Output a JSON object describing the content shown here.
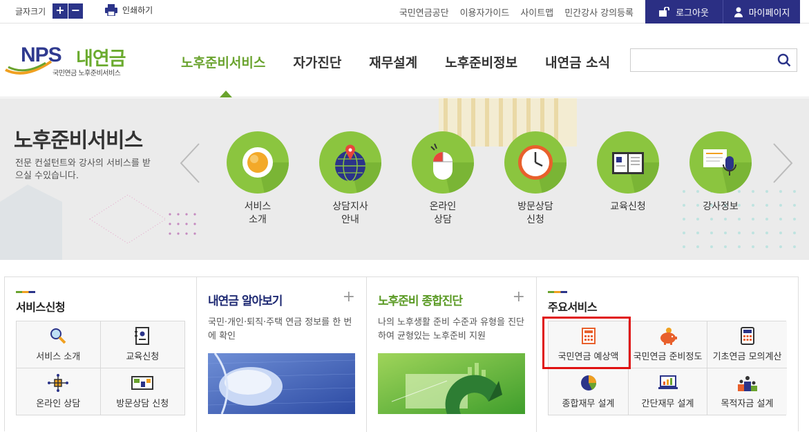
{
  "topbar": {
    "font_size_label": "글자크기",
    "font_plus": "+",
    "font_minus": "−",
    "print_label": "인쇄하기",
    "links": [
      "국민연금공단",
      "이용자가이드",
      "사이트맵",
      "민간강사 강의등록"
    ],
    "logout_label": "로그아웃",
    "mypage_label": "마이페이지",
    "accent_color": "#2b2f84"
  },
  "header": {
    "logo_nps": "NPS",
    "logo_name": "내연금",
    "logo_sub": "국민연금 노후준비서비스",
    "gnb": [
      "노후준비서비스",
      "자가진단",
      "재무설계",
      "노후준비정보",
      "내연금 소식"
    ],
    "gnb_active_color": "#6aa32e",
    "search_placeholder": ""
  },
  "banner": {
    "title": "노후준비서비스",
    "description": "전문 컨설턴트와 강사의 서비스를 받으실 수있습니다.",
    "services": [
      {
        "label": "서비스\n소개",
        "icon": "coffee-cup-icon"
      },
      {
        "label": "상담지사\n안내",
        "icon": "globe-pin-icon"
      },
      {
        "label": "온라인\n상담",
        "icon": "mouse-icon"
      },
      {
        "label": "방문상담\n신청",
        "icon": "clock-icon"
      },
      {
        "label": "교육신청",
        "icon": "book-icon"
      },
      {
        "label": "강사정보",
        "icon": "microphone-icon"
      }
    ]
  },
  "panels": {
    "service_apply": {
      "title": "서비스신청",
      "items": [
        "서비스 소개",
        "교육신청",
        "온라인 상담",
        "방문상담 신청"
      ]
    },
    "my_pension": {
      "title": "내연금 알아보기",
      "description": "국민·개인·퇴직·주택 연금 정보를 한 번에 확인"
    },
    "retirement_diagnosis": {
      "title": "노후준비 종합진단",
      "description": "나의 노후생활 준비 수준과 유형을 진단하여 균형있는 노후준비 지원"
    },
    "main_services": {
      "title": "주요서비스",
      "items": [
        "국민연금 예상액",
        "국민연금 준비정도",
        "기초연금 모의계산",
        "종합재무 설계",
        "간단재무 설계",
        "목적자금 설계"
      ]
    }
  }
}
